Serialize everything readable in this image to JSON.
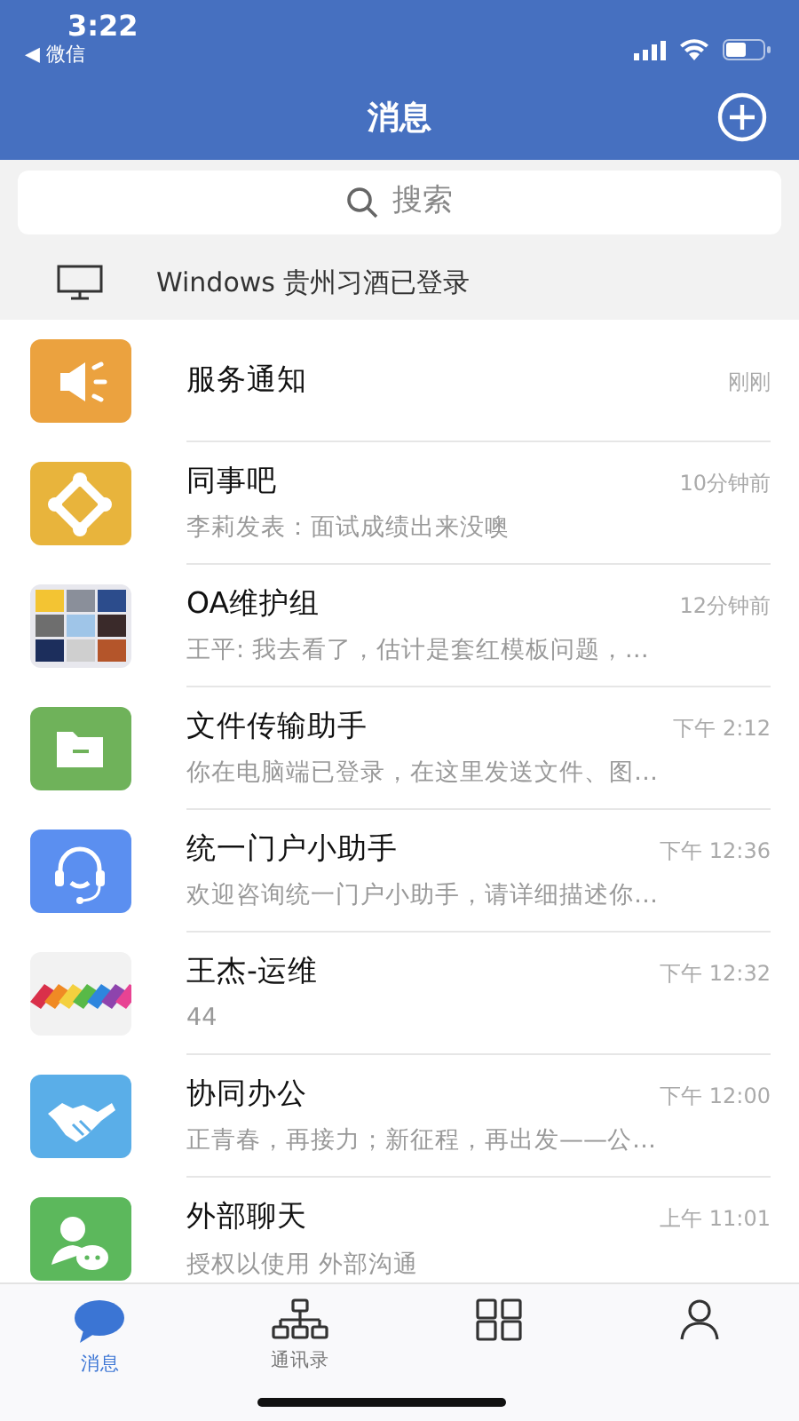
{
  "status_bar": {
    "time": "3:22",
    "back_app": "◀ 微信"
  },
  "header": {
    "title": "消息"
  },
  "search": {
    "placeholder": "搜索"
  },
  "login_notice": {
    "text": "Windows 贵州习酒已登录"
  },
  "conversations": [
    {
      "kind": "megaphone",
      "color": "#eba23f",
      "title": "服务通知",
      "time": "刚刚"
    },
    {
      "kind": "nodes",
      "color": "#e8b43c",
      "title": "同事吧",
      "time": "10分钟前",
      "preview": "李莉发表：面试成绩出来没噢"
    },
    {
      "kind": "group",
      "title": "OA维护组",
      "time": "12分钟前",
      "preview": "王平: 我去看了，估计是套红模板问题，…"
    },
    {
      "kind": "folder",
      "color": "#6fb25a",
      "title": "文件传输助手",
      "time": "下午 2:12",
      "preview": "你在电脑端已登录，在这里发送文件、图…"
    },
    {
      "kind": "headset",
      "color": "#5b8ff0",
      "title": "统一门户小助手",
      "time": "下午 12:36",
      "preview": "欢迎咨询统一门户小助手，请详细描述你…"
    },
    {
      "kind": "picture",
      "title": "王杰-运维",
      "time": "下午 12:32",
      "preview": "44"
    },
    {
      "kind": "handshake",
      "color": "#5aaee8",
      "title": "协同办公",
      "time": "下午 12:00",
      "preview": "正青春，再接力；新征程，再出发——公…"
    },
    {
      "kind": "chat-person",
      "color": "#5cb85c",
      "title": "外部聊天",
      "time": "上午 11:01",
      "preview": "授权以使用 外部沟通"
    }
  ],
  "tabs": [
    {
      "kind": "chat",
      "label": "消息",
      "selected": true
    },
    {
      "kind": "org",
      "label": "通讯录",
      "selected": false
    },
    {
      "kind": "grid",
      "selected": false
    },
    {
      "kind": "person",
      "selected": false
    }
  ]
}
